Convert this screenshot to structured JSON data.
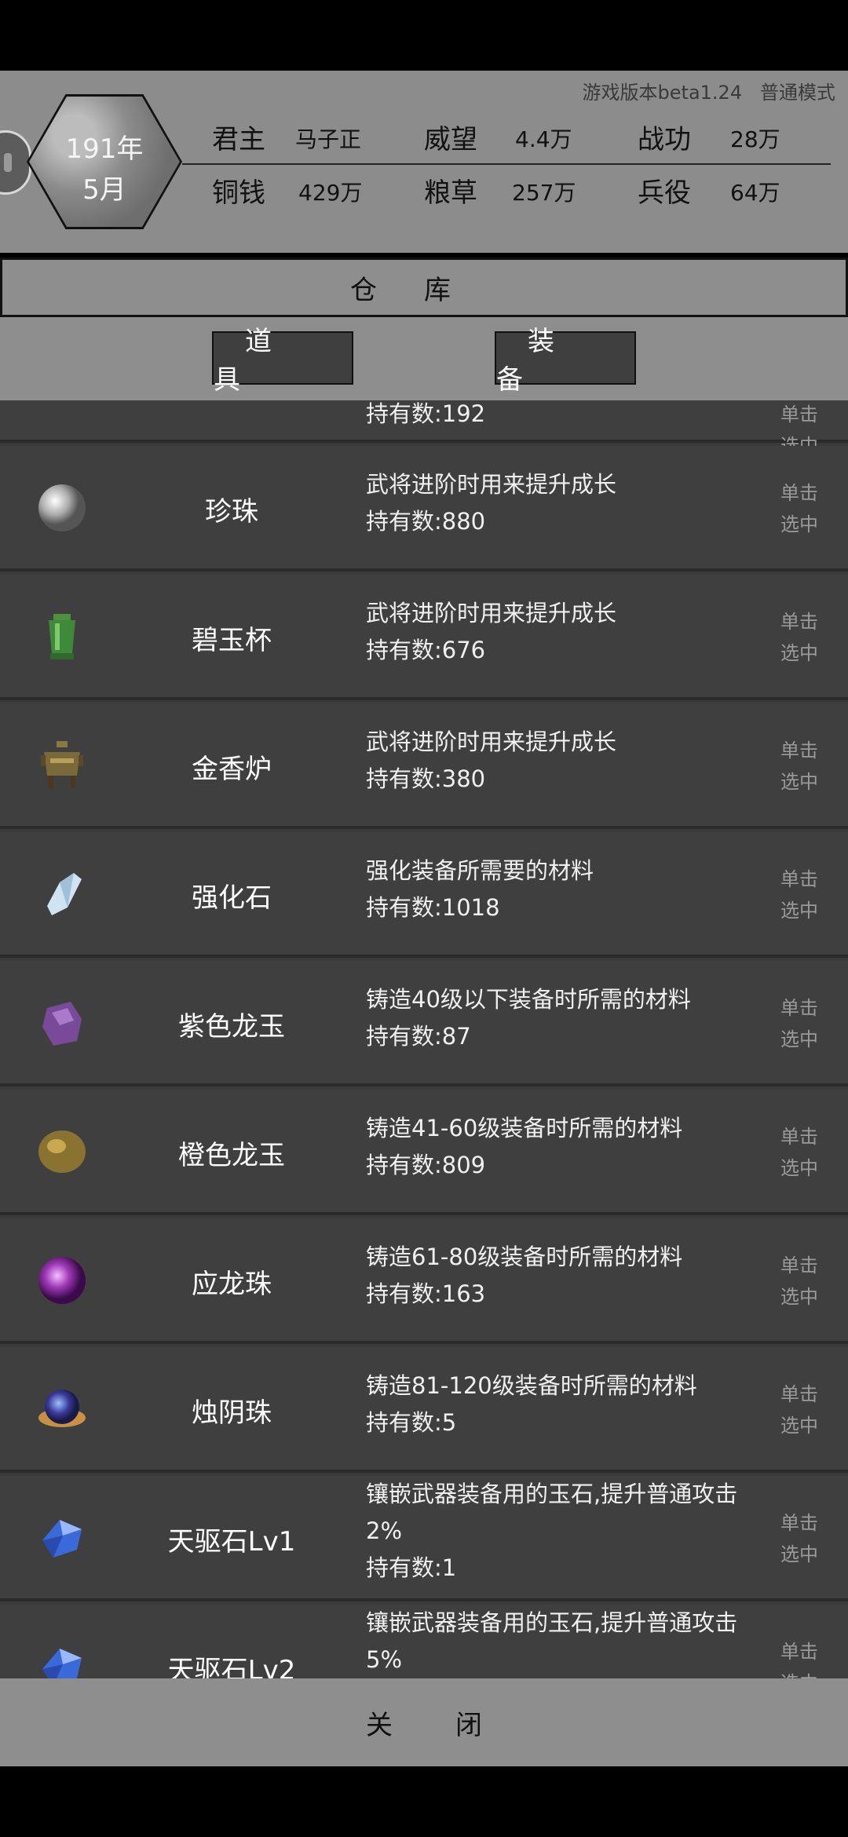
{
  "header": {
    "version": "游戏版本beta1.24",
    "mode": "普通模式",
    "year": "191年",
    "month": "5月",
    "stats": {
      "lord_label": "君主",
      "lord_value": "马子正",
      "prestige_label": "威望",
      "prestige_value": "4.4万",
      "merit_label": "战功",
      "merit_value": "28万",
      "copper_label": "铜钱",
      "copper_value": "429万",
      "grain_label": "粮草",
      "grain_value": "257万",
      "troops_label": "兵役",
      "troops_value": "64万"
    }
  },
  "title": "仓库",
  "tabs": [
    {
      "label": "道具"
    },
    {
      "label": "装备"
    }
  ],
  "select_label": "单击选中",
  "partial_top": {
    "desc_count": "持有数:192"
  },
  "items": [
    {
      "name": "珍珠",
      "desc": "武将进阶时用来提升成长",
      "count": "持有数:880",
      "icon": "pearl-icon"
    },
    {
      "name": "碧玉杯",
      "desc": "武将进阶时用来提升成长",
      "count": "持有数:676",
      "icon": "jade-cup-icon"
    },
    {
      "name": "金香炉",
      "desc": "武将进阶时用来提升成长",
      "count": "持有数:380",
      "icon": "golden-censer-icon"
    },
    {
      "name": "强化石",
      "desc": "强化装备所需要的材料",
      "count": "持有数:1018",
      "icon": "crystal-icon"
    },
    {
      "name": "紫色龙玉",
      "desc": "铸造40级以下装备时所需的材料",
      "count": "持有数:87",
      "icon": "purple-stone-icon"
    },
    {
      "name": "橙色龙玉",
      "desc": "铸造41-60级装备时所需的材料",
      "count": "持有数:809",
      "icon": "orange-stone-icon"
    },
    {
      "name": "应龙珠",
      "desc": "铸造61-80级装备时所需的材料",
      "count": "持有数:163",
      "icon": "dragon-orb-icon"
    },
    {
      "name": "烛阴珠",
      "desc": "铸造81-120级装备时所需的材料",
      "count": "持有数:5",
      "icon": "candle-orb-icon"
    },
    {
      "name": "天驱石Lv1",
      "desc": "镶嵌武器装备用的玉石,提升普通攻击2%",
      "count": "持有数:1",
      "icon": "sapphire-icon"
    },
    {
      "name": "天驱石Lv2",
      "desc": "镶嵌武器装备用的玉石,提升普通攻击5%",
      "count": "",
      "icon": "sapphire-icon"
    }
  ],
  "close_label": "关闭"
}
